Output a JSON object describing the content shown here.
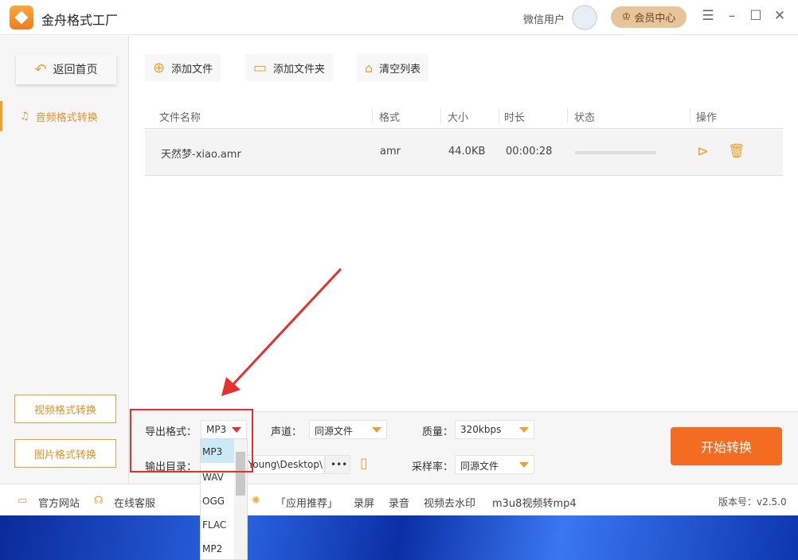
{
  "app": {
    "title": "金舟格式工厂",
    "user": "微信用户",
    "vip": "会员中心",
    "version": "版本号：v2.5.0"
  },
  "sidebar": {
    "home": "返回首页",
    "active": "音频格式转换",
    "video": "视频格式转换",
    "image": "图片格式转换"
  },
  "toolbar": {
    "add_file": "添加文件",
    "add_folder": "添加文件夹",
    "clear": "清空列表"
  },
  "table": {
    "headers": [
      "文件名称",
      "格式",
      "大小",
      "时长",
      "状态",
      "操作"
    ],
    "rows": [
      {
        "name": "天然梦-xiao.amr",
        "format": "amr",
        "size": "44.0KB",
        "duration": "00:00:28",
        "progress": 0
      }
    ]
  },
  "settings": {
    "format_label": "导出格式：",
    "format_value": "MP3",
    "channel_label": "声道：",
    "channel_value": "同源文件",
    "quality_label": "质量：",
    "quality_value": "320kbps",
    "output_label": "输出目录：",
    "output_value": "\\Young\\Desktop\\",
    "more": "•••",
    "rate_label": "采样率：",
    "rate_value": "同源文件",
    "start": "开始转换"
  },
  "dropdown": {
    "options": [
      "MP3",
      "WAV",
      "OGG",
      "FLAC",
      "MP2"
    ],
    "selected": "MP3"
  },
  "footer": {
    "site": "官方网站",
    "service": "在线客服",
    "recommend": "「应用推荐」",
    "links": [
      "录屏",
      "录音",
      "视频去水印",
      "m3u8视频转mp4"
    ]
  },
  "colors": {
    "accent": "#f0a030",
    "start": "#f46b22",
    "annotation": "#e53030"
  }
}
